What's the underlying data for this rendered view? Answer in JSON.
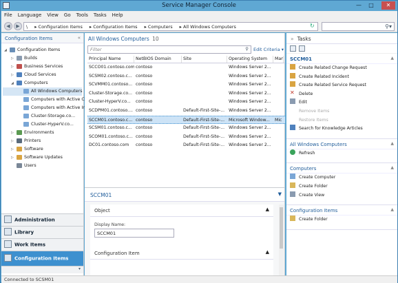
{
  "window": {
    "title": "Service Manager Console"
  },
  "menu": [
    "File",
    "Language",
    "View",
    "Go",
    "Tools",
    "Tasks",
    "Help"
  ],
  "address": {
    "crumbs": [
      "\\",
      "Configuration Items",
      "Configuration Items",
      "Computers",
      "All Windows Computers"
    ],
    "search_value": ""
  },
  "left": {
    "header": "Configuration Items",
    "tree": [
      {
        "label": "Configuration Items",
        "level": 0,
        "expanded": true,
        "icon": "config-items-icon",
        "color": "#6a8fb7"
      },
      {
        "label": "Builds",
        "level": 1,
        "expanded": false,
        "icon": "builds-icon",
        "color": "#8a9bb0"
      },
      {
        "label": "Business Services",
        "level": 1,
        "expanded": false,
        "icon": "business-services-icon",
        "color": "#c0504d"
      },
      {
        "label": "Cloud Services",
        "level": 1,
        "expanded": false,
        "icon": "cloud-services-icon",
        "color": "#4f81bd"
      },
      {
        "label": "Computers",
        "level": 1,
        "expanded": true,
        "icon": "computers-icon",
        "color": "#4f81bd"
      },
      {
        "label": "All Windows Computers",
        "level": 2,
        "selected": true,
        "icon": "computer-icon",
        "color": "#7aa6d6"
      },
      {
        "label": "Computers with Active Ch",
        "level": 2,
        "icon": "computer-icon",
        "color": "#7aa6d6"
      },
      {
        "label": "Computers with Active Inc",
        "level": 2,
        "icon": "computer-icon",
        "color": "#7aa6d6"
      },
      {
        "label": "Cluster-Storage.co...",
        "level": 2,
        "icon": "computer-icon",
        "color": "#7aa6d6"
      },
      {
        "label": "Cluster-HyperV.co...",
        "level": 2,
        "icon": "computer-icon",
        "color": "#7aa6d6"
      },
      {
        "label": "Environments",
        "level": 1,
        "expanded": false,
        "icon": "environments-icon",
        "color": "#5b9a52"
      },
      {
        "label": "Printers",
        "level": 1,
        "expanded": false,
        "icon": "printers-icon",
        "color": "#5a6b7c"
      },
      {
        "label": "Software",
        "level": 1,
        "expanded": false,
        "icon": "software-icon",
        "color": "#d9a441"
      },
      {
        "label": "Software Updates",
        "level": 1,
        "expanded": false,
        "icon": "software-updates-icon",
        "color": "#d9a441"
      },
      {
        "label": "Users",
        "level": 1,
        "icon": "users-icon",
        "color": "#7a8797"
      }
    ],
    "workspaces": [
      {
        "label": "Administration",
        "icon": "administration-icon"
      },
      {
        "label": "Library",
        "icon": "library-icon"
      },
      {
        "label": "Work Items",
        "icon": "work-items-icon"
      },
      {
        "label": "Configuration Items",
        "icon": "configuration-items-icon",
        "active": true
      }
    ]
  },
  "center": {
    "title": "All Windows Computers",
    "count": "10",
    "filter_placeholder": "Filter",
    "edit_criteria": "Edit Criteria",
    "columns": [
      "Principal Name",
      "NetBIOS Domain",
      "Site",
      "Operating System",
      "Manu"
    ],
    "rows": [
      [
        "SCCO01.contoso.com",
        "contoso",
        "",
        "Windows Server 2...",
        ""
      ],
      [
        "SCSM02.contoso.c...",
        "contoso",
        "",
        "Windows Server 2...",
        ""
      ],
      [
        "SCVMM01.contoso...",
        "contoso",
        "",
        "Windows Server 2...",
        ""
      ],
      [
        "Cluster-Storage.co...",
        "contoso",
        "",
        "Windows Server 2...",
        ""
      ],
      [
        "Cluster-HyperV.co...",
        "contoso",
        "",
        "Windows Server 2...",
        ""
      ],
      [
        "SCDPM01.contoso....",
        "contoso",
        "Default-First-Site-...",
        "Windows Server 2...",
        ""
      ],
      [
        "SCCM01.contoso.c...",
        "contoso",
        "Default-First-Site-...",
        "Microsoft Window...",
        "Mic"
      ],
      [
        "SCSM01.contoso.c...",
        "contoso",
        "Default-First-Site-...",
        "Windows Server 2...",
        ""
      ],
      [
        "SCOM01.contoso.c...",
        "contoso",
        "Default-First-Site-...",
        "Windows Server 2...",
        ""
      ],
      [
        "DC01.contoso.com",
        "contoso",
        "Default-First-Site-...",
        "Windows Server 2...",
        ""
      ]
    ],
    "selected_row": 6,
    "detail": {
      "title": "SCCM01",
      "section1": "Object",
      "field_label": "Display Name:",
      "field_value": "SCCM01",
      "section2": "Configuration Item"
    }
  },
  "tasks": {
    "header": "Tasks",
    "sections": [
      {
        "title": "SCCM01",
        "bold": true,
        "items": [
          {
            "label": "Create Related Change Request",
            "icon": "change-request-icon",
            "color": "#d9a441"
          },
          {
            "label": "Create Related Incident",
            "icon": "incident-icon",
            "color": "#d9a441"
          },
          {
            "label": "Create Related Service Request",
            "icon": "service-request-icon",
            "color": "#d9a441"
          },
          {
            "label": "Delete",
            "icon": "delete-icon",
            "color": "#c0392b"
          },
          {
            "label": "Edit",
            "icon": "edit-icon",
            "color": "#8a9bb0"
          },
          {
            "label": "Remove Items",
            "disabled": true
          },
          {
            "label": "Restore Items",
            "disabled": true
          },
          {
            "label": "Search for Knowledge Articles",
            "icon": "knowledge-search-icon",
            "color": "#4f81bd"
          }
        ]
      },
      {
        "title": "All Windows Computers",
        "items": [
          {
            "label": "Refresh",
            "icon": "refresh-icon",
            "color": "#3aa35b"
          }
        ]
      },
      {
        "title": "Computers",
        "items": [
          {
            "label": "Create Computer",
            "icon": "create-computer-icon",
            "color": "#7aa6d6"
          },
          {
            "label": "Create Folder",
            "icon": "folder-icon",
            "color": "#d9b75a"
          },
          {
            "label": "Create View",
            "icon": "view-icon",
            "color": "#8a9bb0"
          }
        ]
      },
      {
        "title": "Configuration Items",
        "items": [
          {
            "label": "Create Folder",
            "icon": "folder-icon",
            "color": "#d9b75a"
          }
        ]
      }
    ]
  },
  "status": "Connected to SCSM01"
}
